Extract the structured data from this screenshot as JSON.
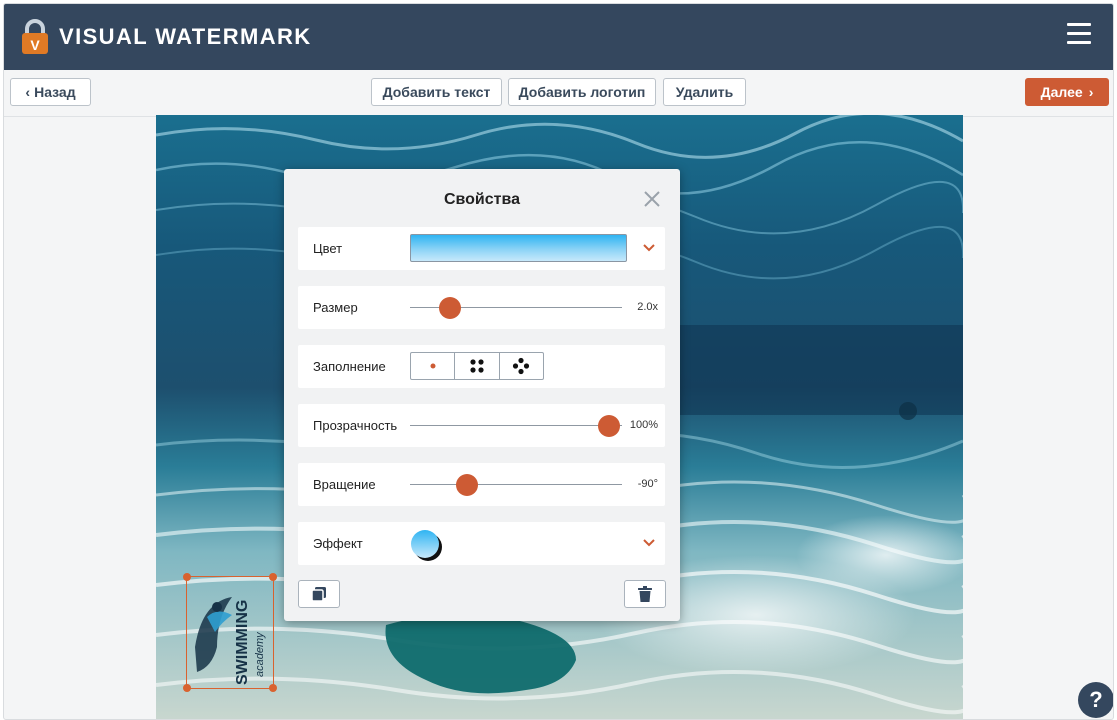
{
  "app": {
    "title": "VISUAL WATERMARK",
    "logo_letter": "V"
  },
  "toolbar": {
    "back_label": "Назад",
    "add_text_label": "Добавить текст",
    "add_logo_label": "Добавить логотип",
    "delete_label": "Удалить",
    "next_label": "Далее"
  },
  "dialog": {
    "title": "Свойства",
    "color": {
      "label": "Цвет",
      "gradient_from": "#2fb4f2",
      "gradient_to": "#c7e9fb"
    },
    "size": {
      "label": "Размер",
      "value": "2.0x",
      "level": 0.19
    },
    "fill": {
      "label": "Заполнение",
      "options": [
        "single",
        "four-dots",
        "five-dots"
      ],
      "selected": "single"
    },
    "opacity": {
      "label": "Прозрачность",
      "value": "100%",
      "level": 0.94
    },
    "rotation": {
      "label": "Вращение",
      "value": "-90°",
      "level": 0.27
    },
    "effect": {
      "label": "Эффект"
    }
  },
  "watermark": {
    "text_main": "SWIMMING",
    "text_sub": "academy"
  },
  "colors": {
    "header": "#34475e",
    "accent": "#cd5b34",
    "selection": "#d9622f"
  },
  "help": {
    "label": "?"
  }
}
